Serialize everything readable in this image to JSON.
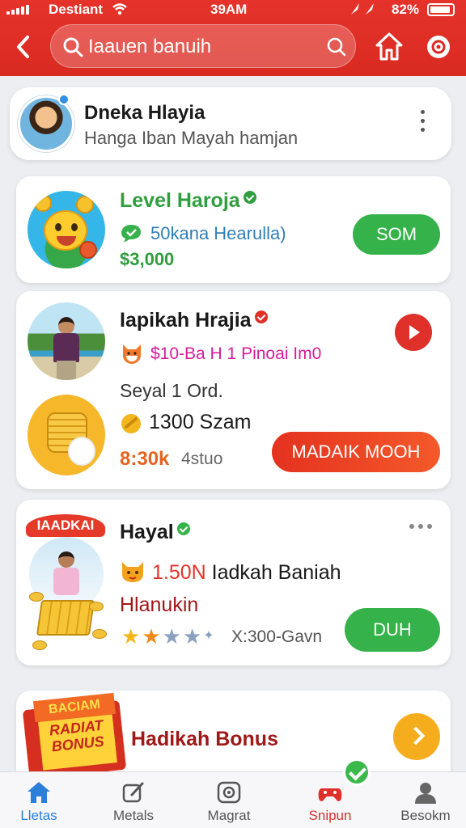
{
  "status_bar": {
    "carrier": "Destiant",
    "time": "39AM",
    "battery": "82%"
  },
  "header": {
    "search_text": "Iaauen banuih"
  },
  "profile": {
    "name": "Dneka Hlayia",
    "subtitle": "Hanga Iban Mayah hamjan"
  },
  "card_level": {
    "title": "Level Haroja",
    "line": "50kana Hearulla)",
    "amount": "$3,000",
    "button": "SOM"
  },
  "card_reward": {
    "title": "Iapikah Hrajia",
    "line": "$10-Ba H 1 Pinoai Im0",
    "sub": "Seyal 1 Ord.",
    "coins": "1300 Szam",
    "amount": "8:30k",
    "amount_suffix": "4stuo",
    "button": "MADAIK MOOH"
  },
  "card_prize": {
    "ribbon": "IAADKAI",
    "title": "Hayal",
    "prize_amount": "1.50N",
    "prize_text": "Iadkah Baniah",
    "sub": "Hlanukin",
    "rating_stars": 4,
    "rating_text": "X:300-Gavn",
    "button": "DUH"
  },
  "card_bonus": {
    "box_top": "BACIAM",
    "box_label_1": "RADIAT",
    "box_label_2": "BONUS",
    "title": "Hadikah Bonus"
  },
  "nav": [
    {
      "label": "Lletas",
      "icon": "home-icon"
    },
    {
      "label": "Metals",
      "icon": "edit-icon"
    },
    {
      "label": "Magrat",
      "icon": "camera-icon"
    },
    {
      "label": "Snipun",
      "icon": "gamepad-icon"
    },
    {
      "label": "Besokm",
      "icon": "profile-icon"
    }
  ],
  "colors": {
    "header_red": "#e5332a",
    "green": "#36b24a",
    "orange_red": "#e4321f",
    "nav_active": "#2a7fd8",
    "star_gold": "#f3b71d",
    "star_grey": "#8aa0bf"
  }
}
